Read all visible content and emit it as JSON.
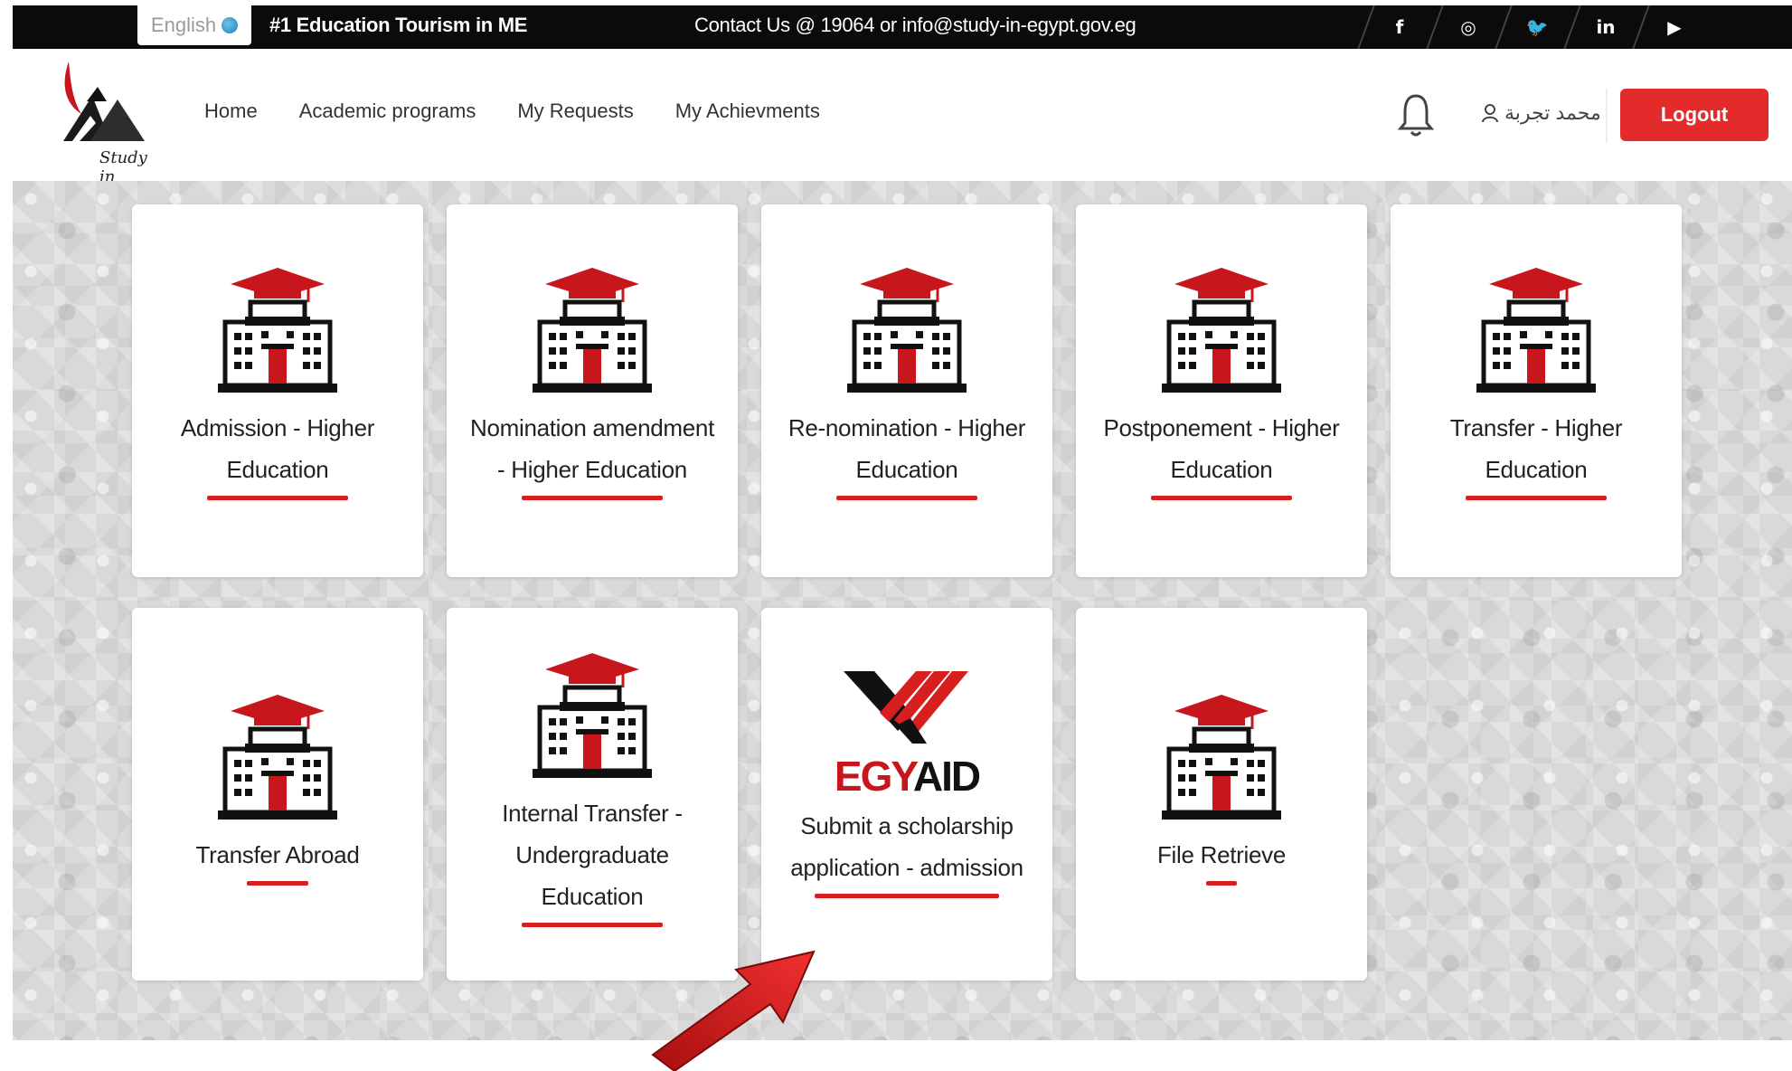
{
  "topbar": {
    "language": "English",
    "tagline": "#1 Education Tourism in ME",
    "contact": "Contact Us @ 19064 or info@study-in-egypt.gov.eg",
    "social": [
      {
        "name": "facebook-icon",
        "glyph": "f"
      },
      {
        "name": "instagram-icon",
        "glyph": "◎"
      },
      {
        "name": "twitter-icon",
        "glyph": "🐦"
      },
      {
        "name": "linkedin-icon",
        "glyph": "in"
      },
      {
        "name": "youtube-icon",
        "glyph": "▶"
      }
    ]
  },
  "nav": {
    "logo_text": "Study in Egypt",
    "links": [
      "Home",
      "Academic programs",
      "My Requests",
      "My Achievments"
    ],
    "user_name": "محمد تجربة",
    "logout": "Logout"
  },
  "services": [
    {
      "line1": "Admission - Higher",
      "line2": "Education",
      "line3": ""
    },
    {
      "line1": "Nomination amendment",
      "line2": "- Higher Education",
      "line3": ""
    },
    {
      "line1": "Re-nomination - Higher",
      "line2": "Education",
      "line3": ""
    },
    {
      "line1": "Postponement - Higher",
      "line2": "Education",
      "line3": ""
    },
    {
      "line1": "Transfer - Higher",
      "line2": "Education",
      "line3": ""
    },
    {
      "line1": "Transfer Abroad",
      "line2": "",
      "line3": ""
    },
    {
      "line1": "Internal Transfer -",
      "line2": "Undergraduate",
      "line3": "Education"
    },
    {
      "brand_a": "EGY",
      "brand_b": "AID",
      "line1": "Submit a scholarship",
      "line2": "application - admission",
      "line3": ""
    },
    {
      "line1": "File Retrieve",
      "line2": "",
      "line3": ""
    }
  ],
  "colors": {
    "accent": "#e42b2b",
    "rule": "#d71f1f",
    "topbar": "#0b0b0b"
  }
}
